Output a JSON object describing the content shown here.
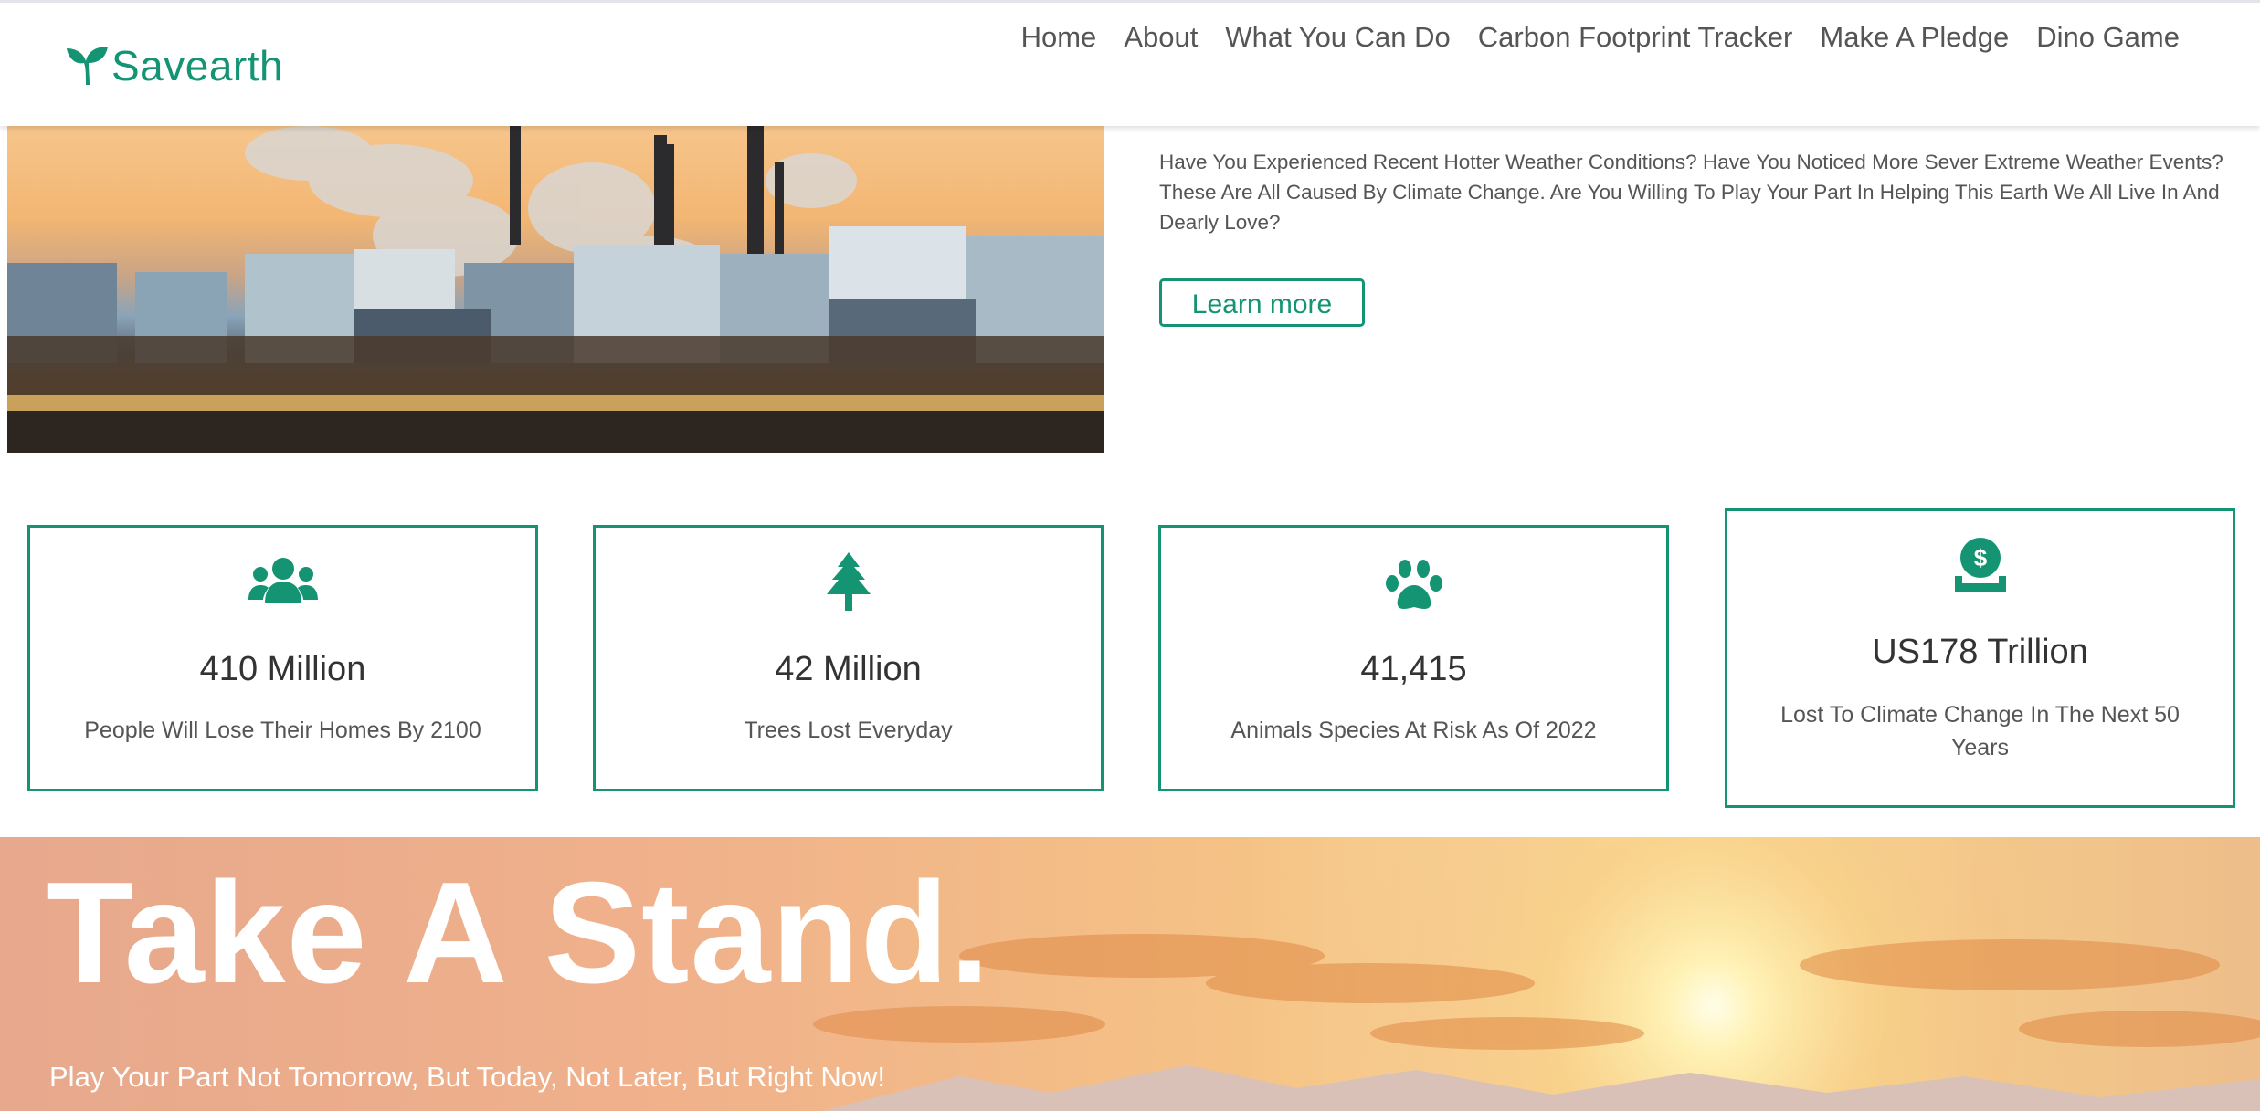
{
  "brand": {
    "name": "Savearth",
    "icon": "seedling-icon",
    "color": "#149473"
  },
  "nav": {
    "items": [
      "Home",
      "About",
      "What You Can Do",
      "Carbon Footprint Tracker",
      "Make A Pledge",
      "Dino Game"
    ]
  },
  "hero": {
    "intro": "Have You Experienced Recent Hotter Weather Conditions? Have You Noticed More Sever Extreme Weather Events? These Are All Caused By Climate Change. Are You Willing To Play Your Part In Helping This Earth We All Live In And Dearly Love?",
    "button_label": "Learn more"
  },
  "stats": [
    {
      "icon": "users-icon",
      "value": "410 Million",
      "label": "People Will Lose Their Homes By 2100"
    },
    {
      "icon": "tree-icon",
      "value": "42 Million",
      "label": "Trees Lost Everyday"
    },
    {
      "icon": "paw-icon",
      "value": "41,415",
      "label": "Animals Species At Risk As Of 2022"
    },
    {
      "icon": "money-hand-icon",
      "value": "US178 Trillion",
      "label": "Lost To Climate Change In The Next 50 Years"
    }
  ],
  "banner": {
    "title": "Take A Stand.",
    "subtitle": "Play Your Part Not Tomorrow, But Today, Not Later, But Right Now!"
  }
}
